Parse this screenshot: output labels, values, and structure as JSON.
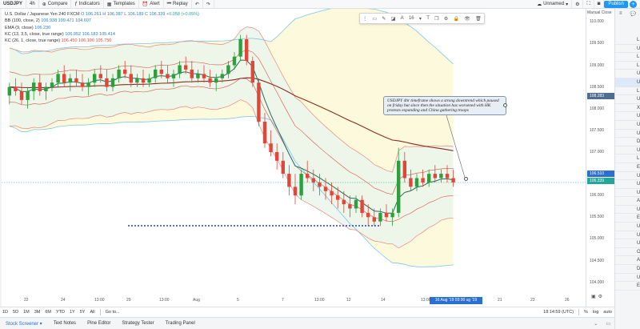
{
  "header": {
    "symbol": "USDJPY",
    "interval": "4h",
    "compare": "Compare",
    "indicators": "Indicators",
    "templates": "Templates",
    "alert": "Alert",
    "replay": "Replay",
    "layout_name": "Unnamed",
    "publish": "Publish"
  },
  "legend": {
    "main_title": "U.S. Dollar / Japanese Yen  240  FXCM",
    "main_values": "O 106.261  H 106.387  L 106.189  C 106.339",
    "main_change": "+0.058 (+0.05%)",
    "bb_title": "BB (100, close, 2)",
    "bb_values": "106.938  109.471  104.607",
    "ema_title": "EMA (9, close)",
    "ema_values": "106.230",
    "kc1_title": "KC (13, 3.5, close, true range)",
    "kc1_values": "106.952  106.183  105.414",
    "kc2_title": "KC (26, 1, close, true range)",
    "kc2_values": "106.450  106.100  105.750"
  },
  "drawing_toolbar": {
    "font_size": "16"
  },
  "callout": {
    "text": "USDJPY 4hr timeframe shows a strong downtrend which paused on friday but since then the situation has worsened with HK protests expanding and China gathering troops"
  },
  "price_axis": {
    "manual_close": "Manual Close",
    "labels": [
      "110.000",
      "109.500",
      "109.000",
      "108.500",
      "108.000",
      "107.500",
      "107.000",
      "106.500",
      "106.000",
      "105.500",
      "105.000",
      "104.500",
      "104.000"
    ],
    "tags": [
      {
        "text": "108.283",
        "color": "#4f6d8f"
      },
      {
        "text": "106.510",
        "color": "#2a6fd2"
      },
      {
        "text": "106.339",
        "color": "#26a69a"
      }
    ]
  },
  "time_axis": {
    "labels": [
      "22",
      "24",
      "13:00",
      "29",
      "13:00",
      "Aug",
      "5",
      "7",
      "13:00",
      "12",
      "14",
      "13:00",
      "21",
      "23",
      "26",
      "28"
    ],
    "cursor_tag": "16 Aug '19  03:00  ug '19  19:00"
  },
  "range_bar": {
    "ranges": [
      "1D",
      "5D",
      "1M",
      "3M",
      "6M",
      "YTD",
      "1Y",
      "5Y",
      "All"
    ],
    "goto": "Go to...",
    "clock": "18:14:59 (UTC)",
    "percent": "%",
    "log": "log",
    "auto": "auto"
  },
  "bottom_tabs": [
    "Stock Screener",
    "Text Notes",
    "Pine Editor",
    "Strategy Tester",
    "Trading Panel"
  ],
  "right_panel": {
    "letters": [
      "L",
      "U",
      "L",
      "L",
      "U",
      "U",
      "L",
      "U",
      "X",
      "U",
      "U",
      "U",
      "D",
      "U",
      "L",
      "E",
      "U",
      "U",
      "U",
      "A",
      "U",
      "E",
      "U",
      "U",
      "U",
      "O",
      "A",
      "D",
      "U",
      "E"
    ]
  },
  "chart_data": {
    "type": "candlestick",
    "title": "U.S. Dollar / Japanese Yen  240  FXCM",
    "ylim": [
      103.7,
      110.3
    ],
    "candles": [
      [
        108.3,
        108.6,
        108.1,
        108.5
      ],
      [
        108.5,
        108.7,
        108.3,
        108.4
      ],
      [
        108.4,
        108.6,
        108.1,
        108.2
      ],
      [
        108.2,
        108.5,
        108.0,
        108.4
      ],
      [
        108.4,
        108.7,
        108.2,
        108.6
      ],
      [
        108.6,
        108.8,
        108.3,
        108.4
      ],
      [
        108.4,
        108.6,
        108.2,
        108.5
      ],
      [
        108.5,
        108.7,
        108.4,
        108.6
      ],
      [
        108.6,
        108.9,
        108.5,
        108.8
      ],
      [
        108.8,
        109.0,
        108.5,
        108.6
      ],
      [
        108.6,
        108.8,
        108.4,
        108.7
      ],
      [
        108.7,
        108.9,
        108.5,
        108.6
      ],
      [
        108.6,
        108.8,
        108.4,
        108.5
      ],
      [
        108.5,
        108.7,
        108.3,
        108.6
      ],
      [
        108.6,
        108.9,
        108.5,
        108.8
      ],
      [
        108.8,
        109.0,
        108.6,
        108.7
      ],
      [
        108.7,
        108.9,
        108.4,
        108.5
      ],
      [
        108.5,
        108.8,
        108.4,
        108.7
      ],
      [
        108.7,
        109.0,
        108.6,
        108.9
      ],
      [
        108.9,
        109.1,
        108.7,
        108.8
      ],
      [
        108.8,
        109.0,
        108.5,
        108.6
      ],
      [
        108.6,
        108.8,
        108.5,
        108.7
      ],
      [
        108.7,
        108.9,
        108.5,
        108.6
      ],
      [
        108.6,
        108.8,
        108.5,
        108.7
      ],
      [
        108.7,
        109.0,
        108.6,
        108.9
      ],
      [
        108.9,
        109.1,
        108.7,
        108.8
      ],
      [
        108.8,
        109.0,
        108.6,
        108.7
      ],
      [
        108.7,
        108.9,
        108.5,
        108.8
      ],
      [
        108.8,
        109.1,
        108.7,
        109.0
      ],
      [
        109.0,
        109.2,
        108.8,
        108.9
      ],
      [
        108.9,
        109.1,
        108.6,
        108.7
      ],
      [
        108.7,
        108.9,
        108.6,
        108.8
      ],
      [
        108.8,
        109.0,
        108.6,
        108.7
      ],
      [
        108.7,
        108.9,
        108.5,
        108.6
      ],
      [
        108.6,
        108.8,
        108.4,
        108.7
      ],
      [
        108.7,
        108.9,
        108.6,
        108.8
      ],
      [
        108.8,
        109.1,
        108.7,
        109.0
      ],
      [
        109.0,
        109.3,
        108.9,
        109.2
      ],
      [
        109.2,
        109.7,
        109.1,
        109.6
      ],
      [
        109.6,
        109.7,
        109.0,
        109.1
      ],
      [
        109.1,
        109.2,
        108.5,
        108.6
      ],
      [
        108.6,
        108.7,
        107.6,
        107.7
      ],
      [
        107.7,
        107.9,
        107.1,
        107.2
      ],
      [
        107.2,
        107.5,
        106.9,
        107.0
      ],
      [
        107.0,
        107.2,
        106.6,
        106.8
      ],
      [
        106.8,
        107.0,
        106.4,
        106.5
      ],
      [
        106.5,
        106.7,
        106.0,
        106.2
      ],
      [
        106.2,
        106.5,
        105.8,
        106.0
      ],
      [
        106.0,
        106.6,
        105.9,
        106.5
      ],
      [
        106.5,
        106.8,
        106.3,
        106.4
      ],
      [
        106.4,
        106.6,
        106.1,
        106.3
      ],
      [
        106.3,
        106.5,
        106.0,
        106.2
      ],
      [
        106.2,
        106.4,
        105.9,
        106.1
      ],
      [
        106.1,
        106.3,
        105.8,
        106.0
      ],
      [
        106.0,
        106.2,
        105.7,
        105.9
      ],
      [
        105.9,
        106.1,
        105.6,
        105.8
      ],
      [
        105.8,
        106.0,
        105.5,
        105.7
      ],
      [
        105.7,
        106.0,
        105.6,
        105.9
      ],
      [
        105.9,
        106.0,
        105.5,
        105.6
      ],
      [
        105.6,
        105.8,
        105.3,
        105.5
      ],
      [
        105.5,
        105.7,
        105.3,
        105.4
      ],
      [
        105.4,
        105.7,
        105.3,
        105.6
      ],
      [
        105.6,
        105.8,
        105.4,
        105.5
      ],
      [
        105.5,
        105.7,
        105.3,
        105.6
      ],
      [
        105.6,
        107.1,
        105.5,
        106.8
      ],
      [
        106.8,
        107.0,
        106.3,
        106.4
      ],
      [
        106.4,
        106.6,
        106.1,
        106.2
      ],
      [
        106.2,
        106.5,
        106.1,
        106.4
      ],
      [
        106.4,
        106.6,
        106.2,
        106.3
      ],
      [
        106.3,
        106.6,
        106.2,
        106.5
      ],
      [
        106.5,
        106.7,
        106.3,
        106.4
      ],
      [
        106.4,
        106.6,
        106.3,
        106.5
      ],
      [
        106.5,
        106.7,
        106.3,
        106.4
      ],
      [
        106.4,
        106.6,
        106.2,
        106.3
      ]
    ]
  }
}
